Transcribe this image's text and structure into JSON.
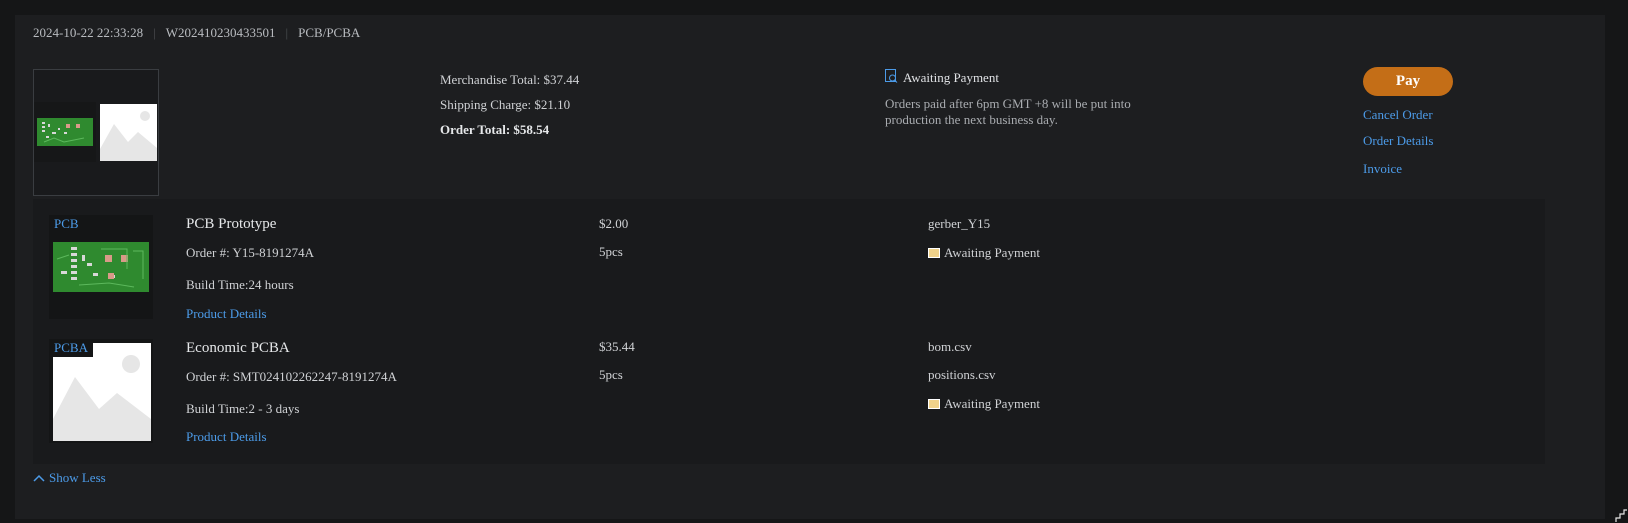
{
  "order": {
    "datetime": "2024-10-22 22:33:28",
    "number": "W202410230433501",
    "category": "PCB/PCBA"
  },
  "summary": {
    "merchandise": "Merchandise Total: $37.44",
    "shipping": "Shipping Charge: $21.10",
    "total": "Order Total: $58.54"
  },
  "status": {
    "label": "Awaiting Payment",
    "note": "Orders paid after 6pm GMT +8 will be put into production the next business day.",
    "icon": "search-document-icon"
  },
  "actions": {
    "pay": "Pay",
    "cancel": "Cancel Order",
    "details": "Order Details",
    "invoice": "Invoice"
  },
  "items": [
    {
      "tag": "PCB",
      "title": "PCB Prototype",
      "order_no": "Order #: Y15-8191274A",
      "build_time": "Build Time:24 hours",
      "details_link": "Product Details",
      "price": "$2.00",
      "qty": "5pcs",
      "files": [
        "gerber_Y15"
      ],
      "status": "Awaiting Payment"
    },
    {
      "tag": "PCBA",
      "title": "Economic PCBA",
      "order_no": "Order #: SMT024102262247-8191274A",
      "build_time": "Build Time:2 - 3 days",
      "details_link": "Product Details",
      "price": "$35.44",
      "qty": "5pcs",
      "files": [
        "bom.csv",
        "positions.csv"
      ],
      "status": "Awaiting Payment"
    }
  ],
  "show_less": "Show Less",
  "colors": {
    "accent": "#4c9be8",
    "pay": "#c46e17",
    "pcb_green": "#2f8a2f"
  }
}
